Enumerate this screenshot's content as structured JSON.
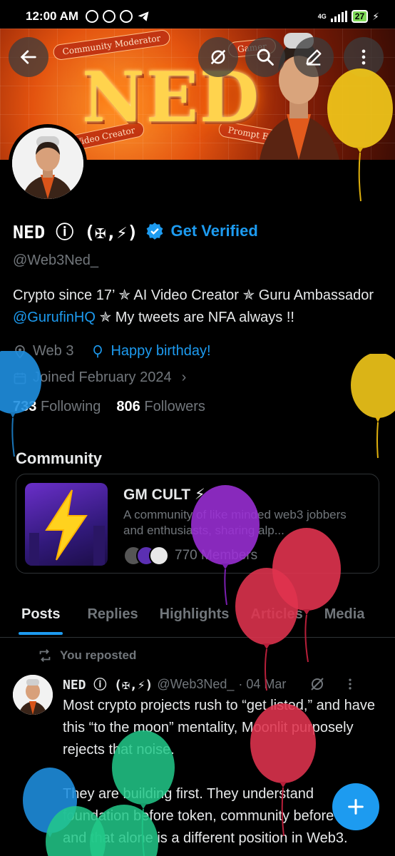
{
  "status_bar": {
    "time": "12:00 AM",
    "network": "4G",
    "battery": "27"
  },
  "banner": {
    "title": "NED",
    "tags": [
      "Community Moderator",
      "Video Creator",
      "Prompt Engineer",
      "Gamer"
    ]
  },
  "profile": {
    "name": "NED ⓘ (✠,⚡)",
    "get_verified": "Get Verified",
    "handle": "@Web3Ned_",
    "bio_part1": "Crypto since 17’ ✯  AI Video Creator ✯ Guru Ambassador ",
    "bio_link": "@GurufinHQ",
    "bio_part2": " ✯ My tweets are NFA always !!",
    "location": "Web 3",
    "birthday": "Happy birthday!",
    "joined": "Joined February 2024",
    "following_count": "733",
    "following_label": "Following",
    "followers_count": "806",
    "followers_label": "Followers"
  },
  "community": {
    "section_title": "Community",
    "name": "GM CULT ⚡",
    "description": "A community of like minded web3 jobbers and enthusiasts, sharing alp...",
    "members": "770 Members"
  },
  "tabs": [
    "Posts",
    "Replies",
    "Highlights",
    "Articles",
    "Media"
  ],
  "repost_label": "You reposted",
  "post": {
    "author": "NED ⓘ (✠,⚡)",
    "handle": "@Web3Ned_",
    "date": "· 04 Mar",
    "text": "Most crypto projects rush to “get listed,” and have this “to the moon” mentality, Moonlit purposely rejects that noise.\n\nThey are building first. They understand foundation before token, community before price, and that alone is a different position in Web3."
  },
  "colors": {
    "accent": "#1d9bf0",
    "background": "#000000",
    "muted": "#71767b"
  }
}
